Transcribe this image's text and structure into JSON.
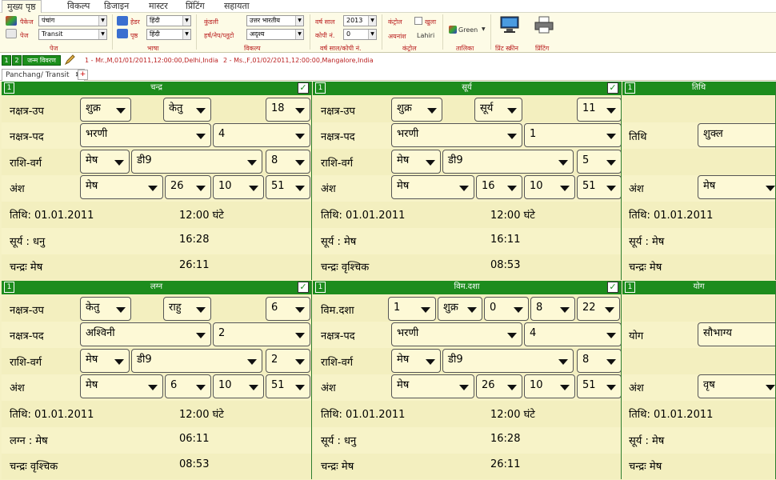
{
  "menu": [
    "मुख्य पृष्ठ",
    "विकल्प",
    "डिजाइन",
    "मास्टर",
    "प्रिंटिंग",
    "सहायता"
  ],
  "ribbon": {
    "package_label": "पैकेज",
    "package_value": "पंचांग",
    "page_label": "पेज",
    "page_value": "Transit",
    "group_page": "पेज",
    "header_label": "हेडर",
    "header_value": "हिंदी",
    "body_label": "पृष्ठ",
    "body_value": "हिंदी",
    "group_language": "भाषा",
    "kundali_label": "कुंडली",
    "kundali_value": "उत्तर भारतीय",
    "harsha_label": "हर्ष/नेप/प्लूटो",
    "harsha_value": "अदृश्य",
    "group_option": "विकल्प",
    "year_label": "वर्ष साल",
    "year_value": "2013",
    "copy_label": "कोपी नं.",
    "copy_value": "0",
    "group_year": "वर्ष साल/कोपी नं.",
    "control_label": "कंट्रोल",
    "open_label": "खुला",
    "ayanamsha_label": "अयनांश",
    "ayanamsha_value": "Lahiri",
    "group_control": "कंट्रोल",
    "theme_value": "Green",
    "group_theme": "तालिका",
    "print_screen": "प्रिंट स्क्रीन",
    "printing": "प्रिंटिंग",
    "colors": {
      "accent": "#1d8c1d",
      "ribbon_bg": "#fdfbe6",
      "panel_bg": "#f7f3c8"
    }
  },
  "infobar": {
    "btn1": "1",
    "btn2": "2",
    "btn3": "जन्म विवरण",
    "person1": "1 - Mr.,M,01/01/2011,12:00:00,Delhi,India",
    "person2": "2 - Ms.,F,01/02/2011,12:00:00,Mangalore,India"
  },
  "tab": {
    "label": "Panchang/ Transit",
    "close": "✖",
    "add": "+"
  },
  "panels": [
    {
      "num": "1",
      "title": "चन्द्र",
      "r1_label": "नक्षत्र-उप",
      "r1": [
        "शुक्र",
        "केतु",
        "18"
      ],
      "r2_label": "नक्षत्र-पद",
      "r2": [
        "भरणी",
        "4"
      ],
      "r3_label": "राशि-वर्ग",
      "r3": [
        "मेष",
        "डी9",
        "8"
      ],
      "r4_label": "अंश",
      "r4": [
        "मेष",
        "26",
        "10",
        "51"
      ],
      "i1a": "तिथि: 01.01.2011",
      "i1b": "12:00 घंटे",
      "i2a": "सूर्य : धनु",
      "i2b": "16:28",
      "i3a": "चन्द्रः मेष",
      "i3b": "26:11"
    },
    {
      "num": "1",
      "title": "सूर्य",
      "r1_label": "नक्षत्र-उप",
      "r1": [
        "शुक्र",
        "सूर्य",
        "11"
      ],
      "r2_label": "नक्षत्र-पद",
      "r2": [
        "भरणी",
        "1"
      ],
      "r3_label": "राशि-वर्ग",
      "r3": [
        "मेष",
        "डी9",
        "5"
      ],
      "r4_label": "अंश",
      "r4": [
        "मेष",
        "16",
        "10",
        "51"
      ],
      "i1a": "तिथि: 01.01.2011",
      "i1b": "12:00 घंटे",
      "i2a": "सूर्य : मेष",
      "i2b": "16:11",
      "i3a": "चन्द्रः वृश्चिक",
      "i3b": "08:53"
    },
    {
      "num": "1",
      "title": "तिथि",
      "r2_label": "तिथि",
      "r2": [
        "शुक्ल"
      ],
      "r4_label": "अंश",
      "r4": [
        "मेष"
      ],
      "i1a": "तिथि: 01.01.2011",
      "i2a": "सूर्य : मेष",
      "i3a": "चन्द्रः मेष"
    },
    {
      "num": "1",
      "title": "लग्न",
      "r1_label": "नक्षत्र-उप",
      "r1": [
        "केतु",
        "राहु",
        "6"
      ],
      "r2_label": "नक्षत्र-पद",
      "r2": [
        "अश्विनी",
        "2"
      ],
      "r3_label": "राशि-वर्ग",
      "r3": [
        "मेष",
        "डी9",
        "2"
      ],
      "r4_label": "अंश",
      "r4": [
        "मेष",
        "6",
        "10",
        "51"
      ],
      "i1a": "तिथि: 01.01.2011",
      "i1b": "12:00 घंटे",
      "i2a": "लग्न : मेष",
      "i2b": "06:11",
      "i3a": "चन्द्रः वृश्चिक",
      "i3b": "08:53"
    },
    {
      "num": "1",
      "title": "विम.दशा",
      "r1_label": "विम.दशा",
      "r1": [
        "1",
        "शुक्र",
        "0",
        "8",
        "22"
      ],
      "r2_label": "नक्षत्र-पद",
      "r2": [
        "भरणी",
        "4"
      ],
      "r3_label": "राशि-वर्ग",
      "r3": [
        "मेष",
        "डी9",
        "8"
      ],
      "r4_label": "अंश",
      "r4": [
        "मेष",
        "26",
        "10",
        "51"
      ],
      "i1a": "तिथि: 01.01.2011",
      "i1b": "12:00 घंटे",
      "i2a": "सूर्य : धनु",
      "i2b": "16:28",
      "i3a": "चन्द्रः मेष",
      "i3b": "26:11"
    },
    {
      "num": "1",
      "title": "योग",
      "r2_label": "योग",
      "r2": [
        "सौभाग्य"
      ],
      "r4_label": "अंश",
      "r4": [
        "वृष"
      ],
      "i1a": "तिथि: 01.01.2011",
      "i2a": "सूर्य : मेष",
      "i3a": "चन्द्रः मेष"
    }
  ]
}
